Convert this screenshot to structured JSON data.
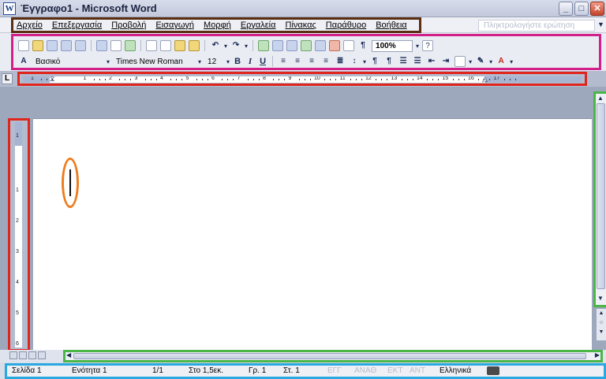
{
  "window": {
    "title": "Έγγραφο1 - Microsoft Word",
    "app_icon": "word-document-icon",
    "buttons": {
      "minimize": "_",
      "maximize": "□",
      "close": "✕"
    }
  },
  "menu": {
    "items": [
      "Αρχείο",
      "Επεξεργασία",
      "Προβολή",
      "Εισαγωγή",
      "Μορφή",
      "Εργαλεία",
      "Πίνακας",
      "Παράθυρο",
      "Βοήθεια"
    ],
    "help_placeholder": "Πληκτρολογήστε ερώτηση"
  },
  "standard_toolbar": {
    "zoom": "100%"
  },
  "formatting_toolbar": {
    "style": "Βασικό",
    "font": "Times New Roman",
    "size": "12",
    "bold": "B",
    "italic": "I",
    "underline": "U"
  },
  "ruler": {
    "numbers": [
      "1",
      "1",
      "2",
      "3",
      "4",
      "5",
      "6",
      "7",
      "8",
      "9",
      "10",
      "11",
      "12",
      "13",
      "14",
      "15",
      "16",
      "17"
    ]
  },
  "vertical_ruler": {
    "numbers": [
      "1",
      "1",
      "2",
      "3",
      "4",
      "5",
      "6"
    ]
  },
  "status_bar": {
    "page": "Σελίδα 1",
    "section": "Ενότητα 1",
    "page_of": "1/1",
    "at": "Στο 1,5εκ.",
    "line": "Γρ. 1",
    "column": "Στ. 1",
    "rec": "ΕΓΓ",
    "track": "ΑΝΑΘ",
    "ext": "ΕΚΤ",
    "ovr": "ΑΝΤ",
    "language": "Ελληνικά"
  }
}
